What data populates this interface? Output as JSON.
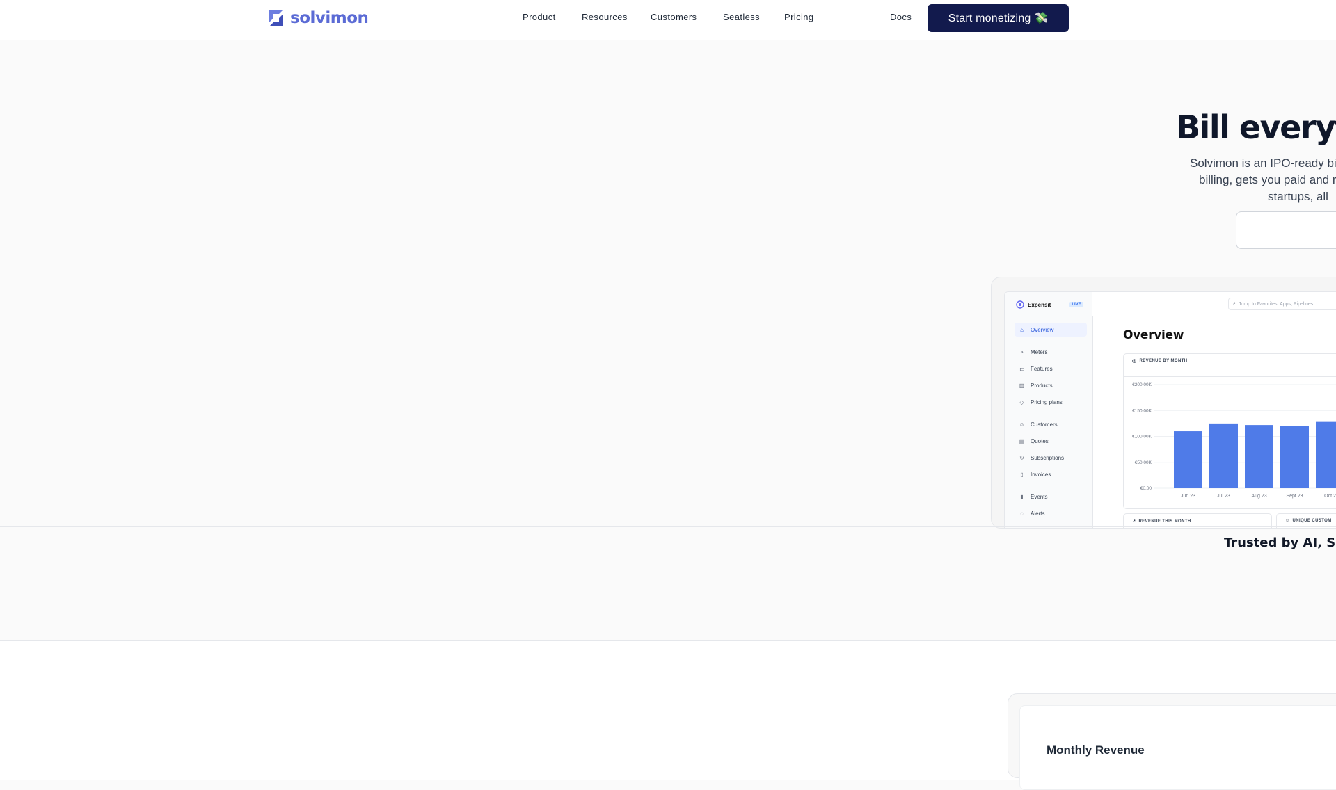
{
  "brand": {
    "name": "solvimon",
    "color": "#5b6bd5"
  },
  "nav": {
    "links": [
      "Product",
      "Resources",
      "Customers",
      "Seatless",
      "Pricing"
    ],
    "docs": "Docs",
    "cta": "Start monetizing 💸"
  },
  "hero": {
    "title": "Bill everyth",
    "lines": [
      "Solvimon is an IPO-ready bil",
      "billing, gets you paid and r",
      "startups, all"
    ]
  },
  "app": {
    "workspace": "Expensit",
    "live_badge": "LIVE",
    "search_placeholder": "Jump to Favorites, Apps, Pipelines...",
    "overview_title": "Overview",
    "sidebar": [
      {
        "label": "Overview",
        "icon": "home-icon"
      },
      {
        "label": "Meters",
        "icon": "gauge-icon"
      },
      {
        "label": "Features",
        "icon": "toggle-icon"
      },
      {
        "label": "Products",
        "icon": "barcode-icon"
      },
      {
        "label": "Pricing plans",
        "icon": "tag-icon"
      },
      {
        "label": "Customers",
        "icon": "users-icon"
      },
      {
        "label": "Quotes",
        "icon": "quote-icon"
      },
      {
        "label": "Subscriptions",
        "icon": "refresh-icon"
      },
      {
        "label": "Invoices",
        "icon": "file-icon"
      },
      {
        "label": "Events",
        "icon": "bar-chart-icon"
      },
      {
        "label": "Alerts",
        "icon": "bell-icon"
      }
    ],
    "revenue_card_title": "REVENUE BY MONTH",
    "mini_cards": [
      "REVENUE THIS MONTH",
      "UNIQUE CUSTOM"
    ]
  },
  "chart_data": {
    "type": "bar",
    "title": "REVENUE BY MONTH",
    "categories": [
      "Jun 23",
      "Jul 23",
      "Aug 23",
      "Sept 23",
      "Oct 2"
    ],
    "values": [
      110,
      125,
      122,
      120,
      128
    ],
    "y_ticks": [
      "€200.00K",
      "€150.00K",
      "€100.00K",
      "€50.00K",
      "€0.00"
    ],
    "ylim": [
      0,
      200
    ],
    "grid": true,
    "color": "#4f7be8"
  },
  "trusted": "Trusted by AI, Saa",
  "section2": {
    "title": "Monthly Revenue"
  }
}
